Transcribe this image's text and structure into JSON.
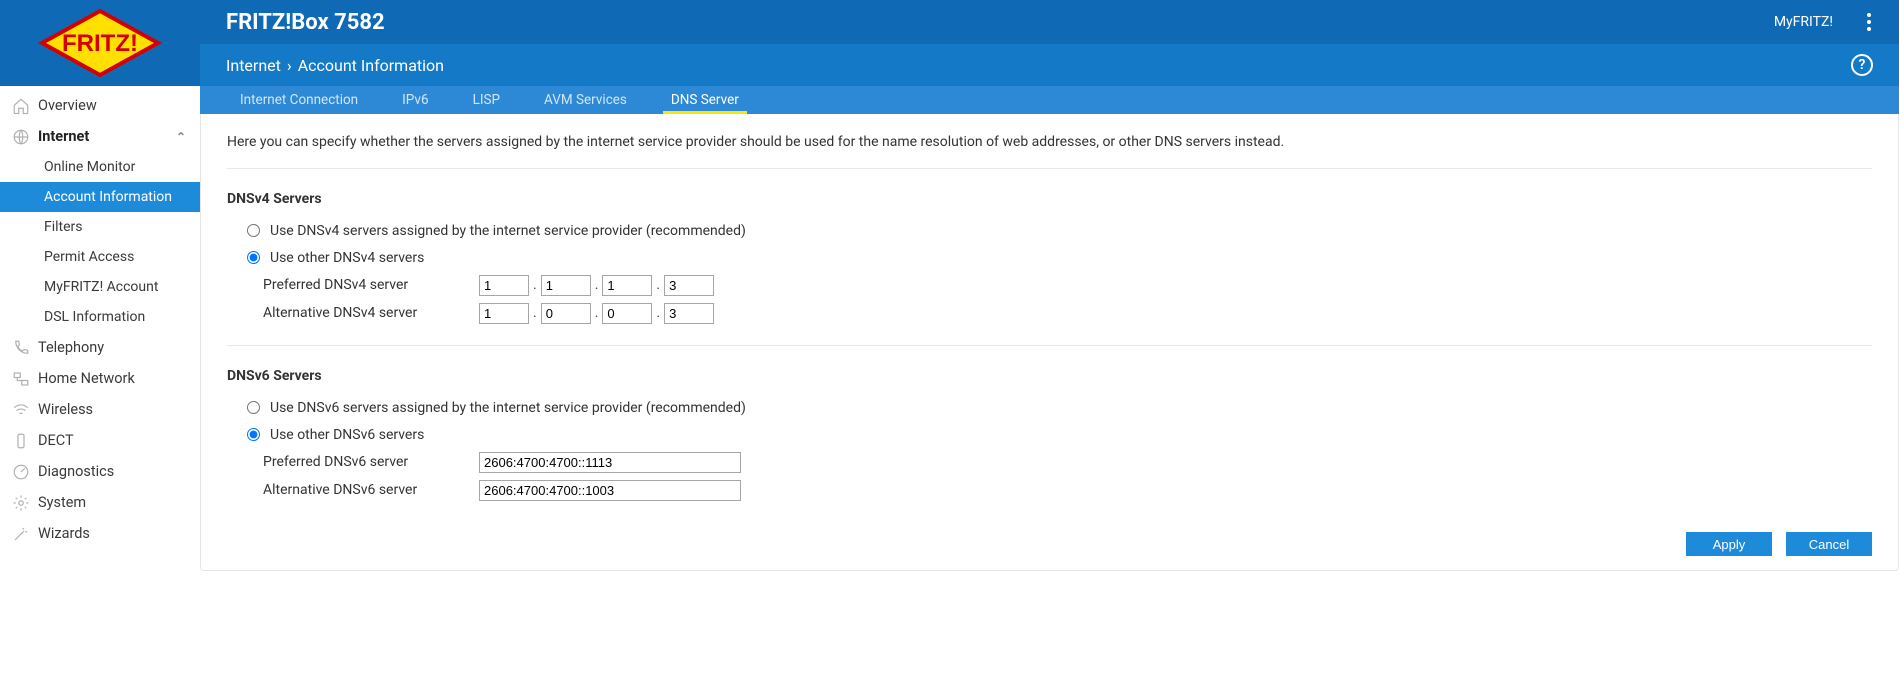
{
  "header": {
    "title": "FRITZ!Box 7582",
    "myfritz": "MyFRITZ!"
  },
  "breadcrumb": {
    "parent": "Internet",
    "current": "Account Information"
  },
  "tabs": [
    {
      "label": "Internet Connection",
      "active": false
    },
    {
      "label": "IPv6",
      "active": false
    },
    {
      "label": "LISP",
      "active": false
    },
    {
      "label": "AVM Services",
      "active": false
    },
    {
      "label": "DNS Server",
      "active": true
    }
  ],
  "sidebar": {
    "items": [
      {
        "label": "Overview",
        "icon": "home"
      },
      {
        "label": "Internet",
        "icon": "globe",
        "expanded": true,
        "children": [
          {
            "label": "Online Monitor"
          },
          {
            "label": "Account Information",
            "active": true
          },
          {
            "label": "Filters"
          },
          {
            "label": "Permit Access"
          },
          {
            "label": "MyFRITZ! Account"
          },
          {
            "label": "DSL Information"
          }
        ]
      },
      {
        "label": "Telephony",
        "icon": "phone"
      },
      {
        "label": "Home Network",
        "icon": "network"
      },
      {
        "label": "Wireless",
        "icon": "wifi"
      },
      {
        "label": "DECT",
        "icon": "dect"
      },
      {
        "label": "Diagnostics",
        "icon": "diag"
      },
      {
        "label": "System",
        "icon": "gear"
      },
      {
        "label": "Wizards",
        "icon": "wand"
      }
    ]
  },
  "content": {
    "description": "Here you can specify whether the servers assigned by the internet service provider should be used for the name resolution of web addresses, or other DNS servers instead.",
    "v4": {
      "heading": "DNSv4 Servers",
      "opt_isp": "Use DNSv4 servers assigned by the internet service provider (recommended)",
      "opt_other": "Use other DNSv4 servers",
      "preferred_label": "Preferred DNSv4 server",
      "alternative_label": "Alternative DNSv4 server",
      "preferred": [
        "1",
        "1",
        "1",
        "3"
      ],
      "alternative": [
        "1",
        "0",
        "0",
        "3"
      ]
    },
    "v6": {
      "heading": "DNSv6 Servers",
      "opt_isp": "Use DNSv6 servers assigned by the internet service provider (recommended)",
      "opt_other": "Use other DNSv6 servers",
      "preferred_label": "Preferred DNSv6 server",
      "alternative_label": "Alternative DNSv6 server",
      "preferred": "2606:4700:4700::1113",
      "alternative": "2606:4700:4700::1003"
    },
    "buttons": {
      "apply": "Apply",
      "cancel": "Cancel"
    }
  }
}
